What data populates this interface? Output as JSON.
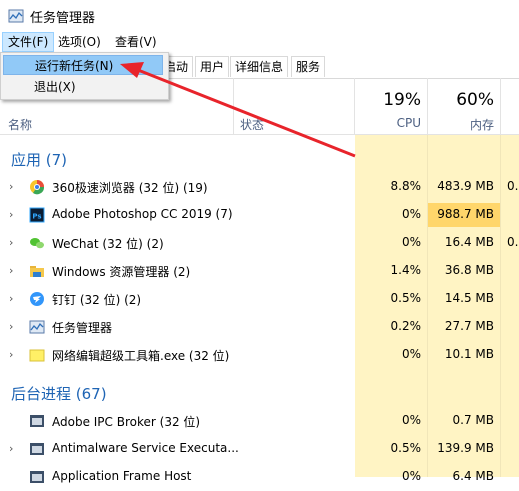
{
  "window": {
    "title": "任务管理器"
  },
  "menu": {
    "file": "文件(F)",
    "options": "选项(O)",
    "view": "查看(V)"
  },
  "dropdown": {
    "run_new_task": "运行新任务(N)",
    "exit": "退出(X)"
  },
  "tabs": [
    "启动",
    "用户",
    "详细信息",
    "服务"
  ],
  "columns": {
    "name": "名称",
    "status": "状态",
    "cpu_pct": "19%",
    "cpu": "CPU",
    "mem_pct": "60%",
    "mem": "内存"
  },
  "groups": {
    "apps": "应用 (7)",
    "background": "后台进程 (67)"
  },
  "apps": [
    {
      "name": "360极速浏览器 (32 位) (19)",
      "cpu": "8.8%",
      "mem": "483.9 MB",
      "ext": "0.",
      "icon": "360-browser-icon"
    },
    {
      "name": "Adobe Photoshop CC 2019 (7)",
      "cpu": "0%",
      "mem": "988.7 MB",
      "ext": "",
      "icon": "photoshop-icon"
    },
    {
      "name": "WeChat (32 位) (2)",
      "cpu": "0%",
      "mem": "16.4 MB",
      "ext": "0.",
      "icon": "wechat-icon"
    },
    {
      "name": "Windows 资源管理器 (2)",
      "cpu": "1.4%",
      "mem": "36.8 MB",
      "ext": "",
      "icon": "folder-icon"
    },
    {
      "name": "钉钉 (32 位) (2)",
      "cpu": "0.5%",
      "mem": "14.5 MB",
      "ext": "",
      "icon": "dingtalk-icon"
    },
    {
      "name": "任务管理器",
      "cpu": "0.2%",
      "mem": "27.7 MB",
      "ext": "",
      "icon": "task-manager-icon"
    },
    {
      "name": "网络编辑超级工具箱.exe (32 位)",
      "cpu": "0%",
      "mem": "10.1 MB",
      "ext": "",
      "icon": "toolbox-icon"
    }
  ],
  "background": [
    {
      "name": "Adobe IPC Broker (32 位)",
      "cpu": "0%",
      "mem": "0.7 MB",
      "icon": "service-icon"
    },
    {
      "name": "Antimalware Service Executa...",
      "cpu": "0.5%",
      "mem": "139.9 MB",
      "icon": "service-icon"
    },
    {
      "name": "Application Frame Host",
      "cpu": "0%",
      "mem": "6.4 MB",
      "icon": "service-icon"
    }
  ]
}
